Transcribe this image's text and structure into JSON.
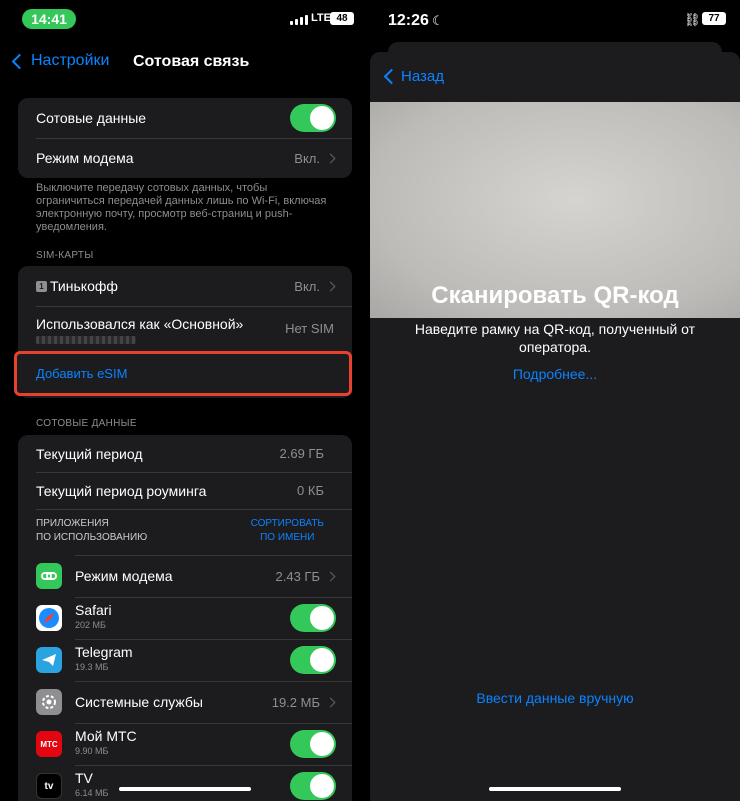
{
  "left": {
    "status": {
      "time": "14:41",
      "network": "LTE",
      "battery": "48"
    },
    "nav": {
      "back_label": "Настройки",
      "title": "Сотовая связь"
    },
    "group1": [
      {
        "label": "Сотовые данные",
        "toggle": "on"
      },
      {
        "label": "Режим модема",
        "value": "Вкл."
      }
    ],
    "note": "Выключите передачу сотовых данных, чтобы ограничиться передачей данных лишь по Wi-Fi, включая электронную почту, просмотр веб-страниц и push-уведомления.",
    "sim_section": "SIM-КАРТЫ",
    "sim": {
      "badge": "1",
      "carrier": "Тинькофф",
      "carrier_value": "Вкл.",
      "secondary_label": "Использовался как «Основной»",
      "secondary_value": "Нет SIM",
      "add_esim": "Добавить eSIM"
    },
    "data_section": "СОТОВЫЕ ДАННЫЕ",
    "usage": [
      {
        "label": "Текущий период",
        "value": "2.69 ГБ"
      },
      {
        "label": "Текущий период роуминга",
        "value": "0 КБ"
      }
    ],
    "apps_header": {
      "left_line1": "ПРИЛОЖЕНИЯ",
      "left_line2": "ПО ИСПОЛЬЗОВАНИЮ",
      "sort_line1": "СОРТИРОВАТЬ",
      "sort_line2": "ПО ИМЕНИ"
    },
    "apps": [
      {
        "name": "Режим модема",
        "value": "2.43 ГБ",
        "icon": "link-icon",
        "color": "#34c759"
      },
      {
        "name": "Safari",
        "sub": "202 МБ",
        "toggle": "on",
        "icon": "compass-icon",
        "color": "#ffffff"
      },
      {
        "name": "Telegram",
        "sub": "19.3 МБ",
        "toggle": "on",
        "icon": "paper-plane-icon",
        "color": "#2aa3e0"
      },
      {
        "name": "Системные службы",
        "value": "19.2 МБ",
        "icon": "gear-icon",
        "color": "#8e8e93"
      },
      {
        "name": "Мой МТС",
        "sub": "9.90 МБ",
        "toggle": "on",
        "icon": "mts-icon",
        "color": "#e30611",
        "icon_text": "МТС"
      },
      {
        "name": "TV",
        "sub": "6.14 МБ",
        "toggle": "on",
        "icon": "apple-tv-icon",
        "color": "#000000",
        "icon_text": "tv"
      }
    ]
  },
  "right": {
    "status": {
      "time": "12:26",
      "battery": "77"
    },
    "back_label": "Назад",
    "title": "Сканировать QR-код",
    "description": "Наведите рамку на QR-код, полученный от оператора.",
    "more_link": "Подробнее...",
    "manual_link": "Ввести данные вручную"
  },
  "colors": {
    "accent": "#0a84ff",
    "toggle_on": "#34c759",
    "highlight": "#e8412f",
    "cell": "#1c1c1e"
  }
}
